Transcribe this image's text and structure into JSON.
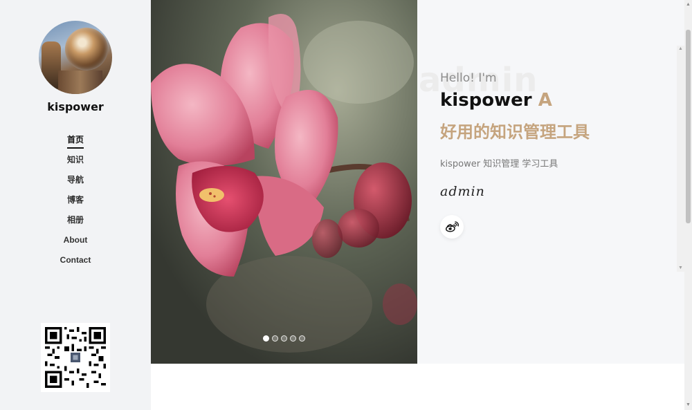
{
  "sidebar": {
    "site_name": "kispower",
    "nav": [
      {
        "label": "首页",
        "active": true
      },
      {
        "label": "知识",
        "active": false
      },
      {
        "label": "导航",
        "active": false
      },
      {
        "label": "博客",
        "active": false
      },
      {
        "label": "相册",
        "active": false
      },
      {
        "label": "About",
        "active": false
      },
      {
        "label": "Contact",
        "active": false
      }
    ]
  },
  "hero": {
    "slide_count": 5,
    "active_slide": 1
  },
  "intro": {
    "ghost_text": "admin",
    "hello": "Hello! I'm",
    "name": "kispower",
    "name_accent": "A",
    "tagline": "好用的知识管理工具",
    "description": "kispower 知识管理 学习工具",
    "signature": "admin",
    "social_icon": "weibo-icon"
  },
  "colors": {
    "accent": "#c5a47e",
    "sidebar_bg": "#f2f3f5",
    "intro_bg": "#f6f7f9"
  }
}
